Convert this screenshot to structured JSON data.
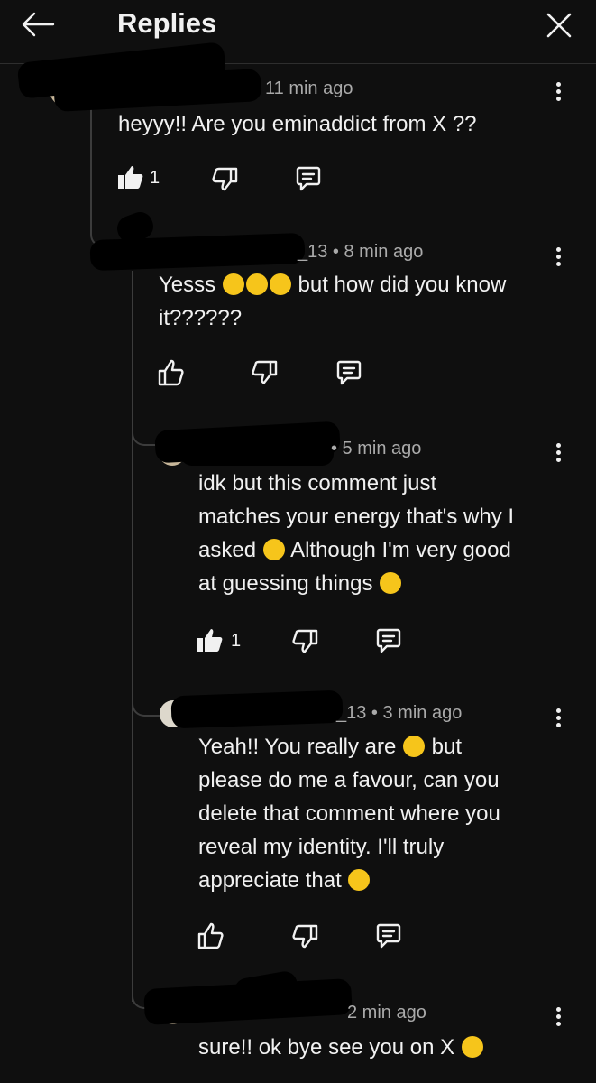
{
  "header": {
    "title": "Replies"
  },
  "comments": [
    {
      "meta": "11 min ago",
      "text": "heyyy!! Are you eminaddict from X ??",
      "like_count": "1"
    },
    {
      "meta": "_13 • 8 min ago",
      "text_line1": "Yesss",
      "text_line1_tail": "but how did you know",
      "text_line2": "it??????"
    },
    {
      "meta": "• 5 min ago",
      "text_line1": "idk but this comment just",
      "text_line2": "matches your energy that's why I",
      "text_line3": "asked",
      "text_line3_tail": "Although I'm very good",
      "text_line4": "at guessing things",
      "like_count": "1"
    },
    {
      "meta": "_13 • 3 min ago",
      "text_line1": "Yeah!! You really are",
      "text_line1_tail": "but",
      "text_line2": "please do me a favour, can you",
      "text_line3": "delete that comment where you",
      "text_line4": "reveal my identity. I'll truly",
      "text_line5": "appreciate that"
    },
    {
      "meta": "2 min ago",
      "text": "sure!! ok bye see you on X"
    }
  ],
  "icons": {
    "back": "arrow-left-icon",
    "close": "close-icon",
    "like": "thumbs-up-icon",
    "dislike": "thumbs-down-icon",
    "reply": "comment-icon",
    "more": "more-vertical-icon"
  },
  "colors": {
    "background": "#0f0f0f",
    "text": "#f1f1f1",
    "meta": "#aaaaaa",
    "thread_line": "#3c3c3c"
  }
}
